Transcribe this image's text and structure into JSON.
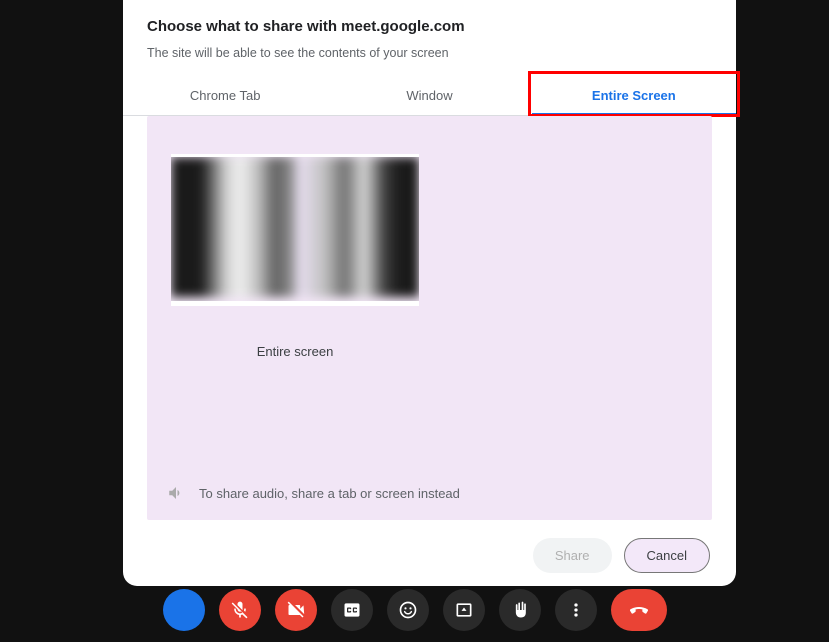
{
  "dialog": {
    "title": "Choose what to share with meet.google.com",
    "subtitle": "The site will be able to see the contents of your screen",
    "tabs": [
      {
        "label": "Chrome Tab",
        "active": false
      },
      {
        "label": "Window",
        "active": false
      },
      {
        "label": "Entire Screen",
        "active": true
      }
    ],
    "thumbnail_label": "Entire screen",
    "audio_hint": "To share audio, share a tab or screen instead",
    "share_label": "Share",
    "cancel_label": "Cancel"
  },
  "toolbar": {
    "items": [
      {
        "name": "unknown-blue",
        "color": "blue"
      },
      {
        "name": "mic-off",
        "color": "off"
      },
      {
        "name": "camera-off",
        "color": "off"
      },
      {
        "name": "captions",
        "color": "dark"
      },
      {
        "name": "reactions",
        "color": "dark"
      },
      {
        "name": "present",
        "color": "dark"
      },
      {
        "name": "raise-hand",
        "color": "dark"
      },
      {
        "name": "more",
        "color": "dark"
      },
      {
        "name": "end-call",
        "color": "off"
      }
    ]
  }
}
